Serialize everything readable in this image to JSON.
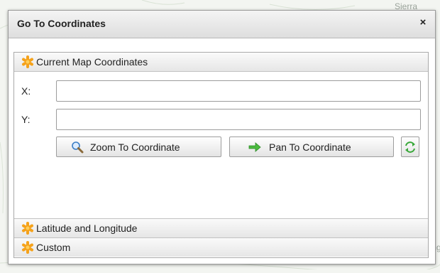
{
  "background": {
    "map_label_top": "Sierra",
    "map_label_right": "mg"
  },
  "dialog": {
    "title": "Go To Coordinates",
    "close_glyph": "×",
    "icons": {
      "close": "close-icon",
      "section": "asterisk-icon",
      "zoom": "magnifier-icon",
      "pan": "arrow-right-icon",
      "swap": "swap-arrows-icon"
    }
  },
  "accordion": {
    "sections": [
      {
        "label": "Current Map Coordinates",
        "expanded": true
      },
      {
        "label": "Latitude and Longitude",
        "expanded": false
      },
      {
        "label": "Custom",
        "expanded": false
      }
    ]
  },
  "current_map": {
    "x_label": "X:",
    "x_value": "",
    "y_label": "Y:",
    "y_value": "",
    "zoom_button": "Zoom To Coordinate",
    "pan_button": "Pan To Coordinate"
  },
  "colors": {
    "accent_orange": "#f5a21b",
    "pan_arrow_green": "#39a83a",
    "zoom_icon_blue": "#3b7dc4"
  }
}
